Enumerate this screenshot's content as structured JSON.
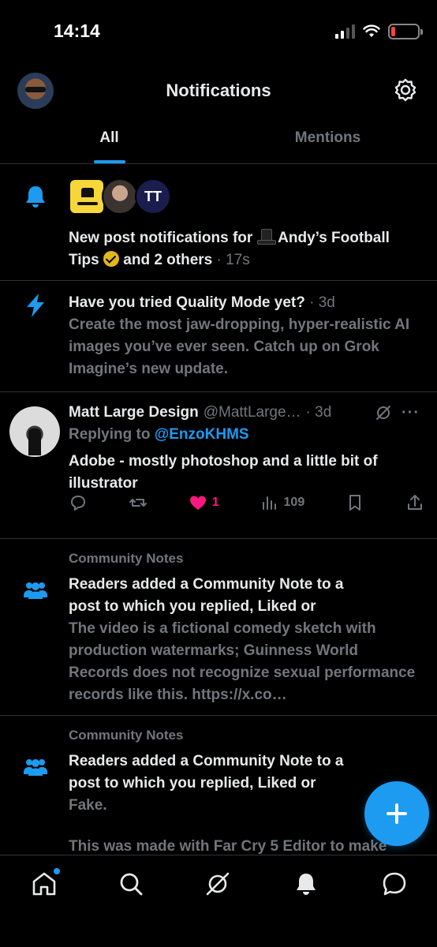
{
  "status_bar": {
    "time": "14:14"
  },
  "header": {
    "title": "Notifications"
  },
  "tabs": [
    {
      "label": "All",
      "active": true
    },
    {
      "label": "Mentions",
      "active": false
    }
  ],
  "notifications": {
    "new_posts": {
      "avatar_3_text": "TT",
      "text_before": "New post notifications for",
      "name": "Andy’s Football Tips",
      "text_after": "and 2 others",
      "time": "· 17s"
    },
    "grok": {
      "title": "Have you tried Quality Mode yet?",
      "time": "· 3d",
      "body": "Create the most jaw-dropping, hyper-realistic AI images you’ve ever seen. Catch up on Grok Imagine’s new update."
    },
    "reply": {
      "name": "Matt Large Design",
      "handle": "@MattLarge…",
      "time": "· 3d",
      "replying_label": "Replying to",
      "replying_to": "@EnzoKHMS",
      "body": "Adobe - mostly photoshop and a little bit of illustrator",
      "likes": "1",
      "views": "109"
    },
    "community_note_1": {
      "label": "Community Notes",
      "title": "Readers added a Community Note to a post to which you replied, Liked or",
      "note": "The video is a fictional comedy sketch with production watermarks; Guinness World Records does not recognize sexual performance records like this. https://x.co…"
    },
    "community_note_2": {
      "label": "Community Notes",
      "title": "Readers added a Community Note to a post to which you replied, Liked or",
      "note": "Fake.",
      "note_cut": "This was made with Far Cry 5 Editor to make"
    }
  },
  "colors": {
    "accent": "#1d9bf0",
    "like": "#f91880",
    "muted": "#71767b",
    "verified": "#e2b719",
    "battery_low": "#ff453a"
  },
  "icons": [
    "bell-icon",
    "lightning-icon",
    "people-icon",
    "gear-icon",
    "home-icon",
    "search-icon",
    "grok-icon",
    "reply-icon",
    "repost-icon",
    "heart-icon",
    "views-icon",
    "bookmark-icon",
    "share-icon",
    "more-icon",
    "compose-icon"
  ]
}
